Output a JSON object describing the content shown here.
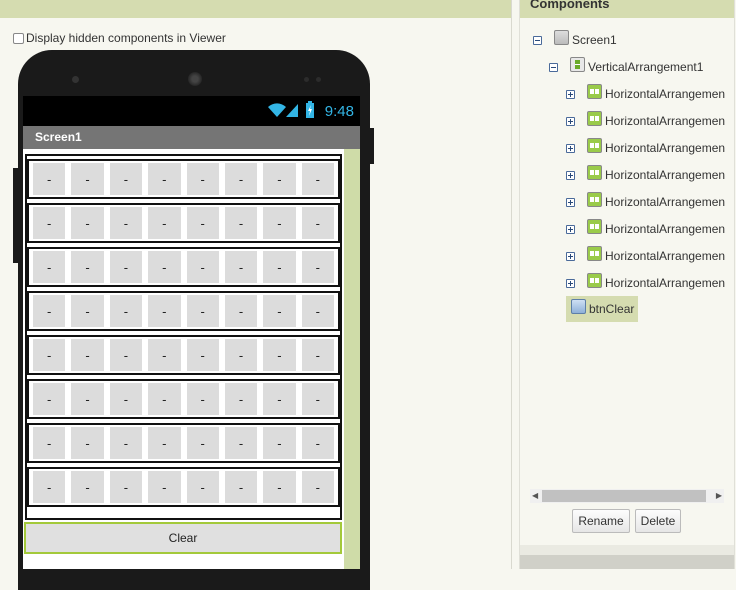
{
  "viewer": {
    "hidden_components_label": "Display hidden components in Viewer",
    "status_time": "9:48",
    "screen_title": "Screen1",
    "cell_text": "-",
    "rows": [
      [
        "-",
        "-",
        "-",
        "-",
        "-",
        "-",
        "-",
        "-"
      ],
      [
        "-",
        "-",
        "-",
        "-",
        "-",
        "-",
        "-",
        "-"
      ],
      [
        "-",
        "-",
        "-",
        "-",
        "-",
        "-",
        "-",
        "-"
      ],
      [
        "-",
        "-",
        "-",
        "-",
        "-",
        "-",
        "-",
        "-"
      ],
      [
        "-",
        "-",
        "-",
        "-",
        "-",
        "-",
        "-",
        "-"
      ],
      [
        "-",
        "-",
        "-",
        "-",
        "-",
        "-",
        "-",
        "-"
      ],
      [
        "-",
        "-",
        "-",
        "-",
        "-",
        "-",
        "-",
        "-"
      ],
      [
        "-",
        "-",
        "-",
        "-",
        "-",
        "-",
        "-",
        "-"
      ]
    ],
    "clear_button": "Clear"
  },
  "components": {
    "title": "Components",
    "tree": {
      "screen": "Screen1",
      "vertical": "VerticalArrangement1",
      "horizontal": [
        "HorizontalArrangemen",
        "HorizontalArrangemen",
        "HorizontalArrangemen",
        "HorizontalArrangemen",
        "HorizontalArrangemen",
        "HorizontalArrangemen",
        "HorizontalArrangemen",
        "HorizontalArrangemen"
      ],
      "button": "btnClear"
    },
    "rename_button": "Rename",
    "delete_button": "Delete"
  },
  "colors": {
    "accent_green": "#d5dcb0",
    "status_clock": "#33b5e5",
    "title_bar": "#757575",
    "selected_border": "#a3c93a"
  }
}
